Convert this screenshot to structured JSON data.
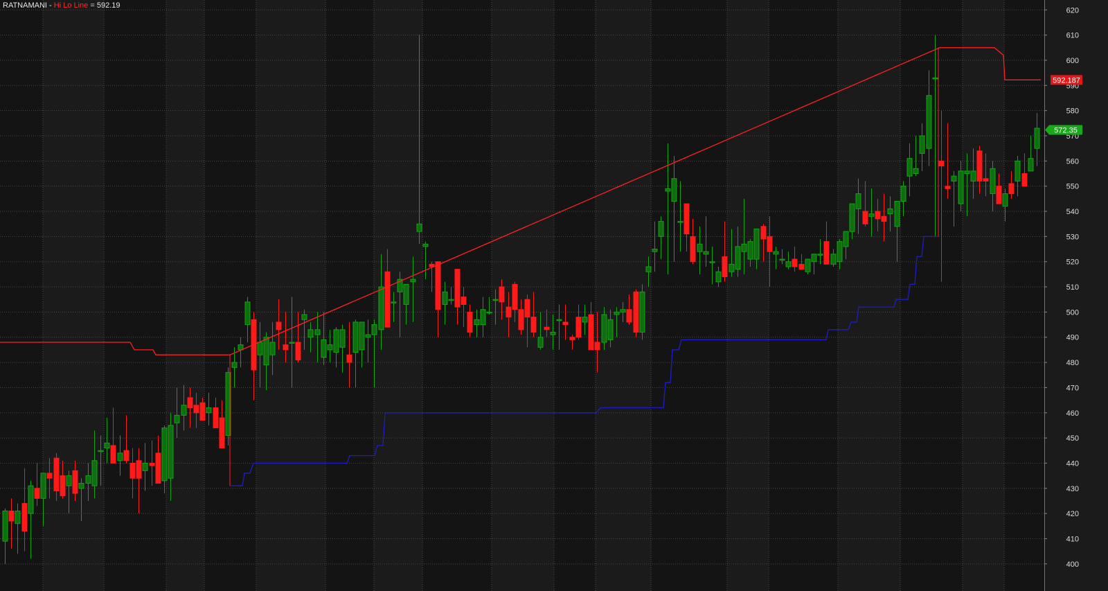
{
  "header": {
    "symbol": "RATNAMANI",
    "separator": " - ",
    "indicator_name": "Hi Lo Line",
    "equals": " = ",
    "indicator_value": "592.19"
  },
  "colors": {
    "background": "#1b1b1b",
    "band": "#141414",
    "grid": "#4a4a4a",
    "up": "#11a511",
    "down": "#ff1a1a",
    "hi_line": "#ff2020",
    "lo_line": "#1e1ec8",
    "axis_text": "#dcdcdc"
  },
  "price_tags": {
    "hi_line_value": "592.187",
    "last_close": "572.35"
  },
  "chart_data": {
    "type": "candlestick",
    "title": "RATNAMANI - Hi Lo Line = 592.19",
    "ylim": [
      395,
      622
    ],
    "yticks": [
      400,
      410,
      420,
      430,
      440,
      450,
      460,
      470,
      480,
      490,
      500,
      510,
      520,
      530,
      540,
      550,
      560,
      570,
      580,
      590,
      600,
      610,
      620
    ],
    "grid": true,
    "candles": [
      [
        409,
        422,
        400,
        421
      ],
      [
        421,
        426,
        406,
        417
      ],
      [
        416,
        424,
        404,
        421
      ],
      [
        424,
        438,
        405,
        413
      ],
      [
        420,
        433,
        402,
        431
      ],
      [
        430,
        440,
        423,
        426
      ],
      [
        426,
        433,
        415,
        436
      ],
      [
        436,
        442,
        426,
        434
      ],
      [
        442,
        444,
        425,
        429
      ],
      [
        435,
        441,
        426,
        427
      ],
      [
        431,
        437,
        420,
        435
      ],
      [
        437,
        441,
        425,
        428
      ],
      [
        430,
        434,
        417,
        432
      ],
      [
        432,
        440,
        425,
        435
      ],
      [
        431,
        453,
        426,
        441
      ],
      [
        445,
        451,
        431,
        445
      ],
      [
        446,
        458,
        440,
        448
      ],
      [
        447,
        462,
        440,
        440
      ],
      [
        441,
        451,
        435,
        444
      ],
      [
        445,
        459,
        440,
        441
      ],
      [
        440,
        446,
        426,
        434
      ],
      [
        441,
        446,
        420,
        434
      ],
      [
        437,
        448,
        429,
        440
      ],
      [
        440,
        449,
        431,
        439
      ],
      [
        444,
        451,
        438,
        432
      ],
      [
        433,
        455,
        428,
        454
      ],
      [
        434,
        460,
        425,
        455
      ],
      [
        456,
        470,
        450,
        459
      ],
      [
        459,
        471,
        453,
        463
      ],
      [
        466,
        470,
        454,
        462
      ],
      [
        463,
        468,
        454,
        460
      ],
      [
        464,
        466,
        457,
        457
      ],
      [
        460,
        468,
        455,
        462
      ],
      [
        462,
        466,
        457,
        454
      ],
      [
        458,
        465,
        448,
        446
      ],
      [
        451,
        478,
        447,
        476
      ],
      [
        478,
        486,
        470,
        480
      ],
      [
        485,
        490,
        478,
        487
      ],
      [
        495,
        506,
        488,
        504
      ],
      [
        497,
        500,
        465,
        477
      ],
      [
        483,
        496,
        470,
        488
      ],
      [
        479,
        492,
        469,
        490
      ],
      [
        483,
        496,
        475,
        488
      ],
      [
        496,
        505,
        485,
        493
      ],
      [
        487,
        500,
        480,
        485
      ],
      [
        488,
        506,
        470,
        488
      ],
      [
        488,
        500,
        480,
        481
      ],
      [
        497,
        501,
        485,
        499
      ],
      [
        490,
        496,
        484,
        493
      ],
      [
        491,
        500,
        480,
        493
      ],
      [
        482,
        500,
        479,
        489
      ],
      [
        485,
        493,
        480,
        487
      ],
      [
        484,
        494,
        478,
        493
      ],
      [
        486,
        495,
        476,
        493
      ],
      [
        483,
        496,
        470,
        480
      ],
      [
        484,
        497,
        470,
        496
      ],
      [
        485,
        494,
        478,
        496
      ],
      [
        490,
        497,
        480,
        491
      ],
      [
        491,
        497,
        470,
        495
      ],
      [
        493,
        523,
        485,
        510
      ],
      [
        516,
        525,
        494,
        494
      ],
      [
        504,
        508,
        496,
        504
      ],
      [
        508,
        516,
        490,
        513
      ],
      [
        503,
        505,
        495,
        511
      ],
      [
        512,
        522,
        496,
        513
      ],
      [
        532,
        610,
        527,
        535
      ],
      [
        526,
        528,
        513,
        527
      ],
      [
        519,
        520,
        508,
        518
      ],
      [
        520,
        520,
        490,
        501
      ],
      [
        503,
        512,
        495,
        508
      ],
      [
        505,
        510,
        503,
        505
      ],
      [
        517,
        510,
        495,
        502
      ],
      [
        506,
        510,
        494,
        503
      ],
      [
        500,
        503,
        490,
        492
      ],
      [
        495,
        501,
        490,
        497
      ],
      [
        495,
        506,
        490,
        501
      ],
      [
        500,
        506,
        499,
        500
      ],
      [
        505,
        509,
        495,
        505
      ],
      [
        510,
        513,
        497,
        504
      ],
      [
        502,
        508,
        490,
        498
      ],
      [
        511,
        512,
        496,
        501
      ],
      [
        501,
        505,
        491,
        493
      ],
      [
        505,
        507,
        486,
        498
      ],
      [
        498,
        508,
        490,
        492
      ],
      [
        486,
        500,
        485,
        490
      ],
      [
        494,
        501,
        490,
        493
      ],
      [
        491,
        499,
        485,
        492
      ],
      [
        497,
        503,
        485,
        497
      ],
      [
        496,
        503,
        489,
        495
      ],
      [
        490,
        491,
        485,
        489
      ],
      [
        498,
        503,
        489,
        490
      ],
      [
        496,
        503,
        491,
        498
      ],
      [
        499,
        504,
        490,
        485
      ],
      [
        488,
        500,
        476,
        485
      ],
      [
        488,
        502,
        485,
        499
      ],
      [
        489,
        501,
        486,
        497
      ],
      [
        499,
        502,
        490,
        500
      ],
      [
        500,
        504,
        496,
        501
      ],
      [
        501,
        507,
        495,
        496
      ],
      [
        508,
        509,
        490,
        492
      ],
      [
        492,
        511,
        489,
        508
      ],
      [
        516,
        522,
        510,
        518
      ],
      [
        524,
        536,
        516,
        525
      ],
      [
        530,
        538,
        521,
        536
      ],
      [
        548,
        567,
        515,
        549
      ],
      [
        544,
        562,
        520,
        553
      ],
      [
        536,
        552,
        524,
        536
      ],
      [
        543,
        540,
        524,
        531
      ],
      [
        530,
        537,
        519,
        520
      ],
      [
        524,
        534,
        515,
        527
      ],
      [
        523,
        538,
        518,
        524
      ],
      [
        520,
        526,
        511,
        520
      ],
      [
        512,
        518,
        510,
        516
      ],
      [
        522,
        536,
        512,
        514
      ],
      [
        516,
        533,
        514,
        519
      ],
      [
        517,
        534,
        514,
        526
      ],
      [
        524,
        545,
        515,
        527
      ],
      [
        521,
        529,
        518,
        528
      ],
      [
        521,
        532,
        517,
        533
      ],
      [
        534,
        535,
        520,
        529
      ],
      [
        530,
        538,
        510,
        524
      ],
      [
        523,
        526,
        517,
        524
      ],
      [
        521,
        525,
        519,
        521
      ],
      [
        518,
        524,
        517,
        520
      ],
      [
        521,
        526,
        516,
        518
      ],
      [
        519,
        523,
        518,
        517
      ],
      [
        516,
        520,
        515,
        521
      ],
      [
        520,
        523,
        515,
        523
      ],
      [
        523,
        529,
        519,
        523
      ],
      [
        528,
        536,
        520,
        519
      ],
      [
        519,
        525,
        518,
        523
      ],
      [
        520,
        529,
        517,
        528
      ],
      [
        526,
        531,
        521,
        532
      ],
      [
        532,
        543,
        529,
        543
      ],
      [
        541,
        553,
        531,
        547
      ],
      [
        540,
        552,
        534,
        535
      ],
      [
        538,
        549,
        530,
        539
      ],
      [
        540,
        545,
        532,
        537
      ],
      [
        538,
        547,
        528,
        536
      ],
      [
        539,
        546,
        532,
        541
      ],
      [
        534,
        544,
        520,
        544
      ],
      [
        544,
        552,
        538,
        550
      ],
      [
        554,
        567,
        546,
        561
      ],
      [
        555,
        570,
        554,
        557
      ],
      [
        563,
        575,
        556,
        570
      ],
      [
        565,
        596,
        558,
        586
      ],
      [
        593,
        610,
        530,
        593
      ],
      [
        560,
        580,
        512,
        558
      ],
      [
        550,
        575,
        545,
        549
      ],
      [
        552,
        556,
        534,
        554
      ],
      [
        543,
        560,
        540,
        556
      ],
      [
        555,
        563,
        538,
        556
      ],
      [
        552,
        565,
        545,
        556
      ],
      [
        564,
        566,
        547,
        552
      ],
      [
        553,
        563,
        546,
        552
      ],
      [
        547,
        560,
        540,
        557
      ],
      [
        550,
        555,
        547,
        543
      ],
      [
        542,
        549,
        536,
        547
      ],
      [
        551,
        556,
        545,
        547
      ],
      [
        552,
        562,
        546,
        560
      ],
      [
        555,
        563,
        555,
        550
      ],
      [
        556,
        570,
        557,
        561
      ],
      [
        565,
        579,
        558,
        573
      ]
    ],
    "hi_line_steps": [
      [
        0,
        488
      ],
      [
        188,
        488
      ],
      [
        194,
        485
      ],
      [
        221,
        485
      ],
      [
        225,
        483
      ],
      [
        332,
        483
      ],
      [
        1357,
        605
      ],
      [
        1436,
        605
      ],
      [
        1449,
        602
      ],
      [
        1451,
        592.19
      ],
      [
        1503,
        592.19
      ]
    ],
    "lo_line_steps": [
      [
        332,
        431
      ],
      [
        350,
        431
      ],
      [
        353,
        436
      ],
      [
        361,
        436
      ],
      [
        366,
        440
      ],
      [
        501,
        440
      ],
      [
        505,
        443
      ],
      [
        541,
        443
      ],
      [
        545,
        447
      ],
      [
        553,
        447
      ],
      [
        556,
        460
      ],
      [
        861,
        460
      ],
      [
        867,
        462
      ],
      [
        958,
        462
      ],
      [
        961,
        472
      ],
      [
        968,
        472
      ],
      [
        971,
        485
      ],
      [
        980,
        485
      ],
      [
        984,
        489
      ],
      [
        1193,
        489
      ],
      [
        1196,
        493
      ],
      [
        1225,
        493
      ],
      [
        1229,
        496
      ],
      [
        1237,
        496
      ],
      [
        1240,
        502
      ],
      [
        1291,
        502
      ],
      [
        1294,
        505
      ],
      [
        1311,
        505
      ],
      [
        1314,
        511
      ],
      [
        1321,
        511
      ],
      [
        1324,
        522
      ],
      [
        1331,
        522
      ],
      [
        1334,
        530
      ],
      [
        1355,
        530
      ]
    ],
    "hi_line_price_label": "592.187",
    "last_price_label": "572.35",
    "indicator": "Hi Lo Line",
    "symbol": "RATNAMANI"
  }
}
